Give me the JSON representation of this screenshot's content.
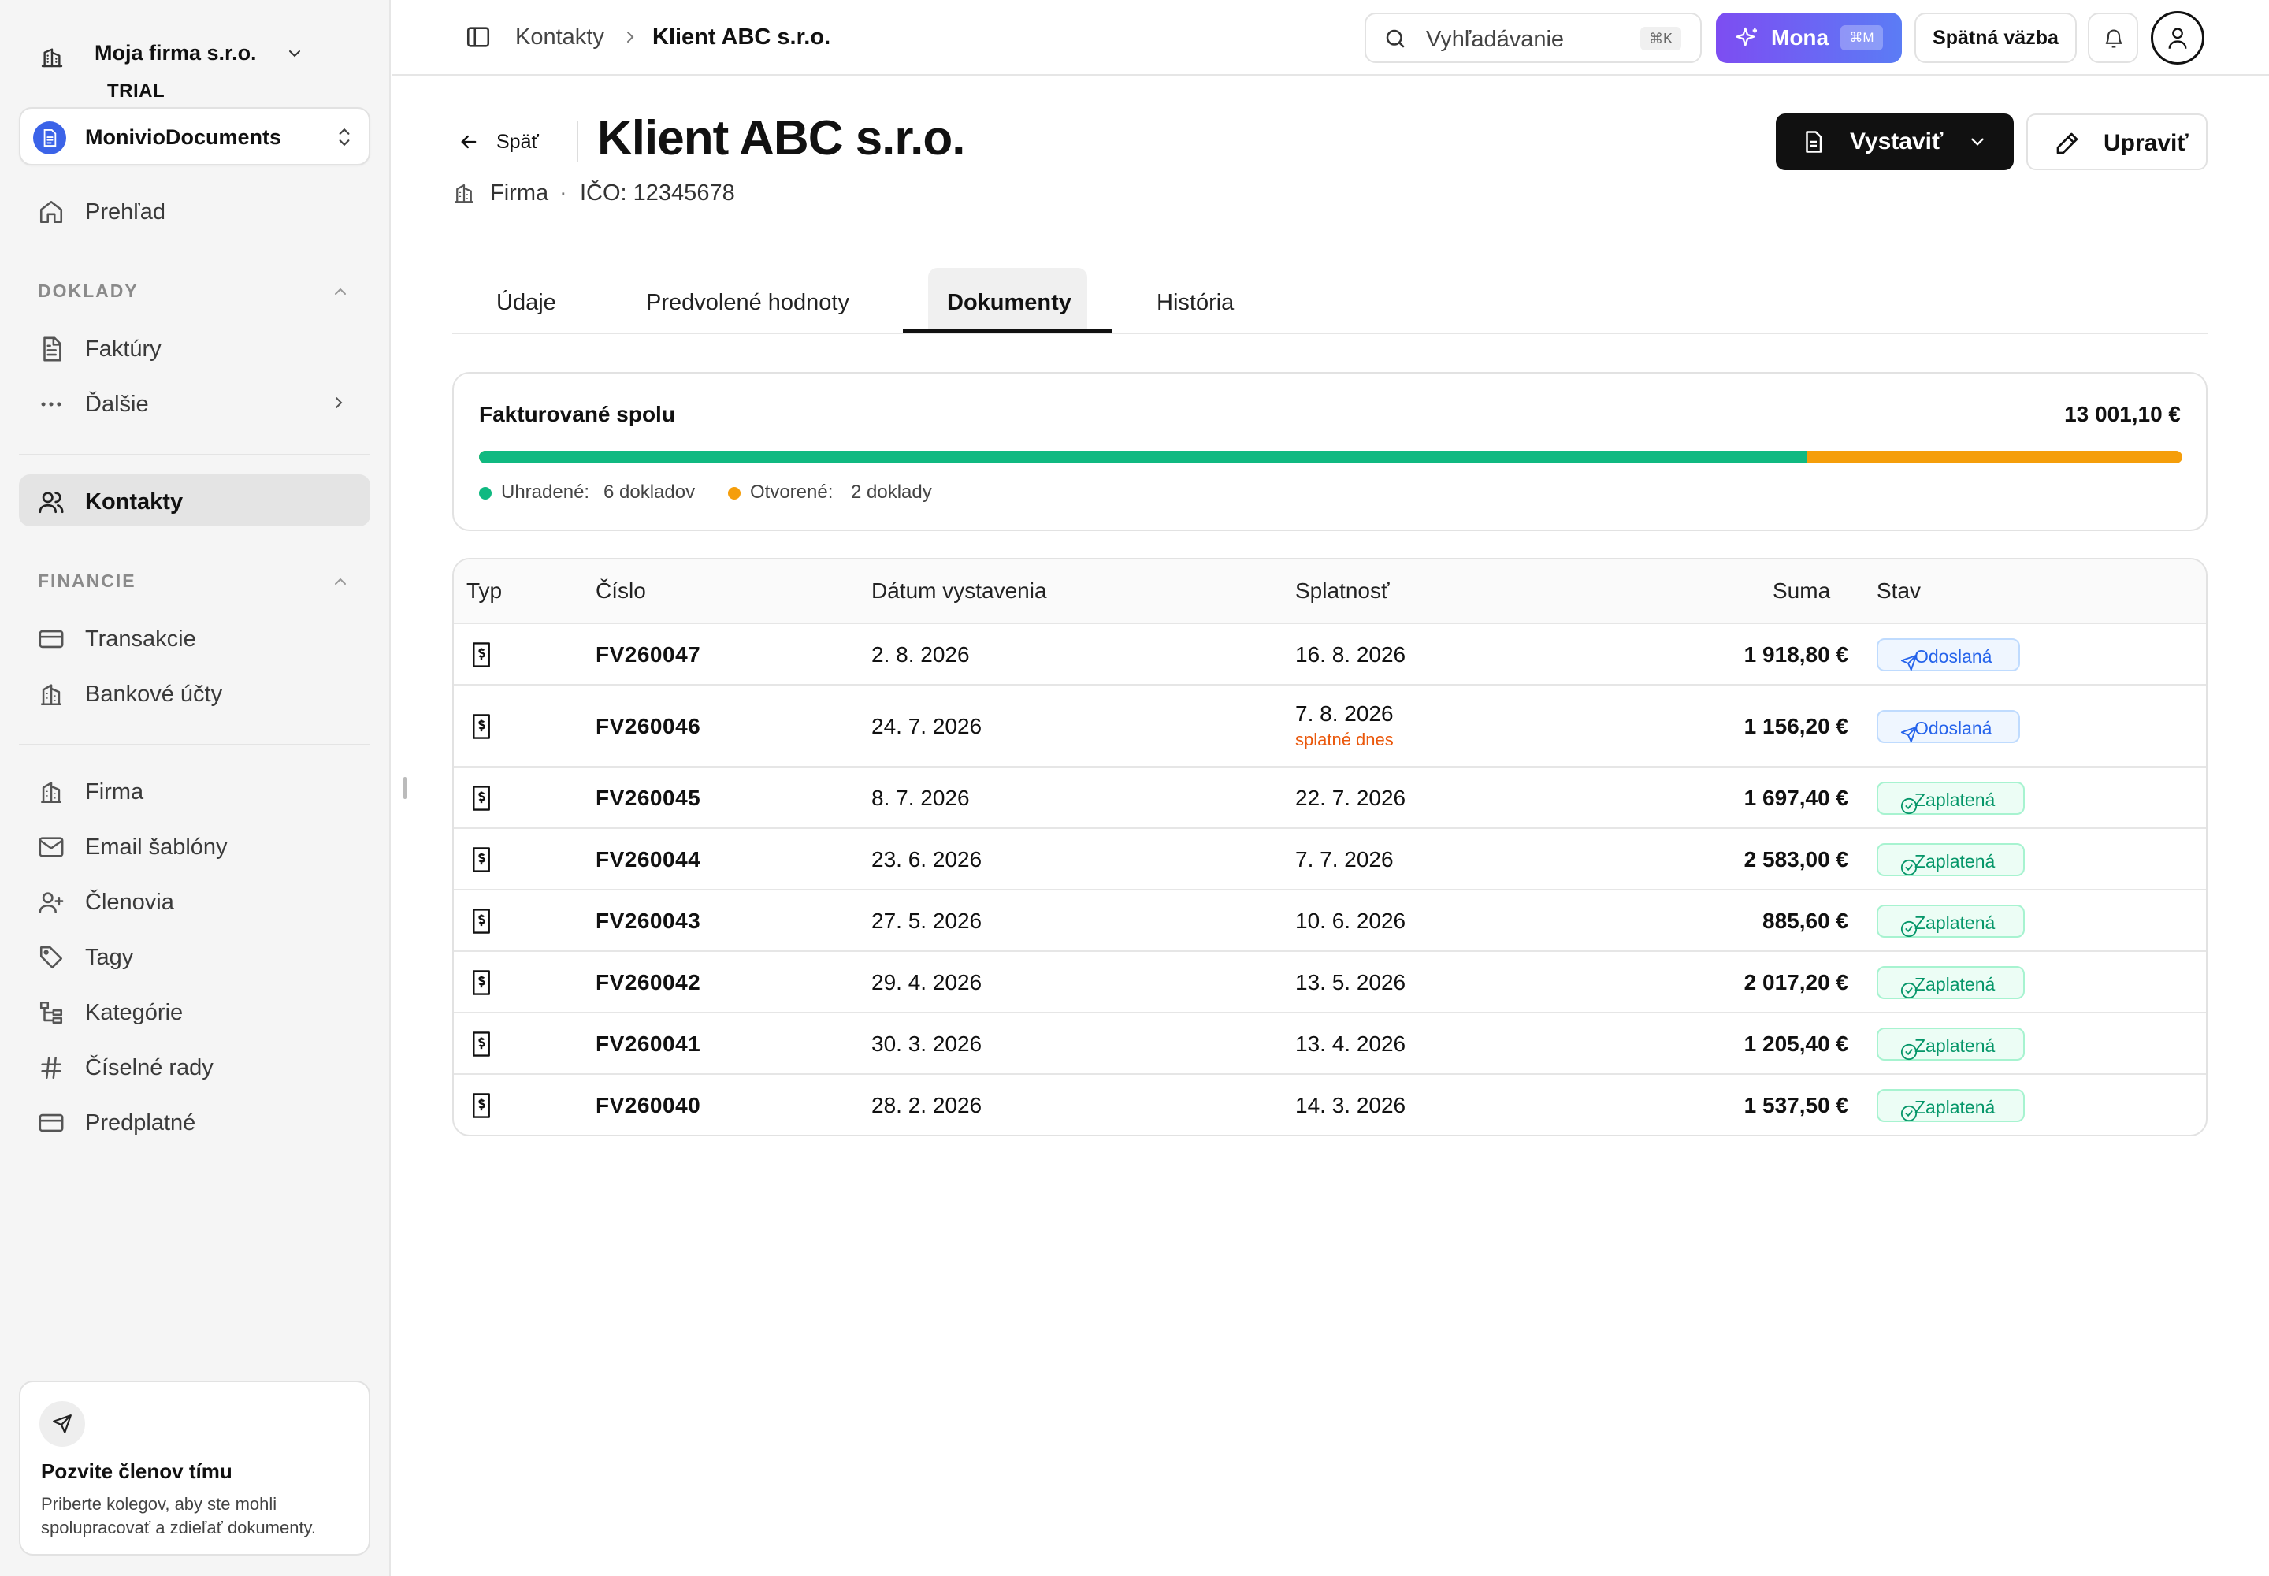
{
  "sidebar": {
    "company_name": "Moja firma s.r.o.",
    "plan": "TRIAL",
    "workspace": "MonivioDocuments",
    "overview": "Prehľad",
    "sections": {
      "doklady": "DOKLADY",
      "financie": "FINANCIE"
    },
    "items": {
      "faktury": "Faktúry",
      "dalsie": "Ďalšie",
      "kontakty": "Kontakty",
      "transakcie": "Transakcie",
      "bankove_ucty": "Bankové účty",
      "firma": "Firma",
      "email_sablony": "Email šablóny",
      "clenovia": "Členovia",
      "tagy": "Tagy",
      "kategorie": "Kategórie",
      "ciselne_rady": "Číselné rady",
      "predplatne": "Predplatné"
    },
    "invite": {
      "title": "Pozvite členov tímu",
      "description": "Priberte kolegov, aby ste mohli spolupracovať a zdieľať dokumenty."
    }
  },
  "topbar": {
    "breadcrumb": [
      "Kontakty",
      "Klient ABC s.r.o."
    ],
    "search_placeholder": "Vyhľadávanie",
    "search_shortcut": "⌘K",
    "mona_label": "Mona",
    "mona_shortcut": "⌘M",
    "feedback_label": "Spätná väzba"
  },
  "header": {
    "back_label": "Späť",
    "title": "Klient ABC s.r.o.",
    "entity_type": "Firma",
    "ico": "IČO: 12345678",
    "issue_button": "Vystaviť",
    "edit_button": "Upraviť"
  },
  "tabs": [
    "Údaje",
    "Predvolené hodnoty",
    "Dokumenty",
    "História"
  ],
  "active_tab": "Dokumenty",
  "summary": {
    "label": "Fakturované spolu",
    "total": "13 001,10 €",
    "paid_label": "Uhradené:",
    "paid_value": "6 dokladov",
    "open_label": "Otvorené:",
    "open_value": "2 doklady",
    "paid_fraction": 0.78,
    "colors": {
      "paid": "#10b981",
      "open": "#f59e0b"
    }
  },
  "table": {
    "columns": [
      "Typ",
      "Číslo",
      "Dátum vystavenia",
      "Splatnosť",
      "Suma",
      "Stav"
    ],
    "rows": [
      {
        "type_icon": "invoice-icon",
        "number": "FV260047",
        "issued": "2. 8. 2026",
        "due": "16. 8. 2026",
        "due_note": "",
        "amount": "1 918,80 €",
        "status": "Odoslaná",
        "status_kind": "sent"
      },
      {
        "type_icon": "invoice-icon",
        "number": "FV260046",
        "issued": "24. 7. 2026",
        "due": "7. 8. 2026",
        "due_note": "splatné dnes",
        "amount": "1 156,20 €",
        "status": "Odoslaná",
        "status_kind": "sent"
      },
      {
        "type_icon": "invoice-icon",
        "number": "FV260045",
        "issued": "8. 7. 2026",
        "due": "22. 7. 2026",
        "due_note": "",
        "amount": "1 697,40 €",
        "status": "Zaplatená",
        "status_kind": "paid"
      },
      {
        "type_icon": "invoice-icon",
        "number": "FV260044",
        "issued": "23. 6. 2026",
        "due": "7. 7. 2026",
        "due_note": "",
        "amount": "2 583,00 €",
        "status": "Zaplatená",
        "status_kind": "paid"
      },
      {
        "type_icon": "invoice-icon",
        "number": "FV260043",
        "issued": "27. 5. 2026",
        "due": "10. 6. 2026",
        "due_note": "",
        "amount": "885,60 €",
        "status": "Zaplatená",
        "status_kind": "paid"
      },
      {
        "type_icon": "invoice-icon",
        "number": "FV260042",
        "issued": "29. 4. 2026",
        "due": "13. 5. 2026",
        "due_note": "",
        "amount": "2 017,20 €",
        "status": "Zaplatená",
        "status_kind": "paid"
      },
      {
        "type_icon": "invoice-icon",
        "number": "FV260041",
        "issued": "30. 3. 2026",
        "due": "13. 4. 2026",
        "due_note": "",
        "amount": "1 205,40 €",
        "status": "Zaplatená",
        "status_kind": "paid"
      },
      {
        "type_icon": "invoice-icon",
        "number": "FV260040",
        "issued": "28. 2. 2026",
        "due": "14. 3. 2026",
        "due_note": "",
        "amount": "1 537,50 €",
        "status": "Zaplatená",
        "status_kind": "paid"
      }
    ]
  }
}
